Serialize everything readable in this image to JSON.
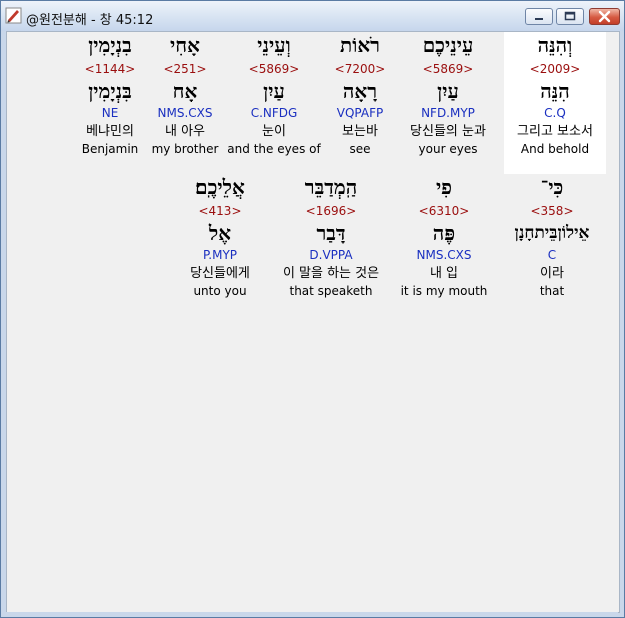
{
  "window": {
    "title": "@원전분해 - 창 45:12",
    "controls": {
      "minimize": "minimize-icon",
      "maximize": "maximize-icon",
      "close": "close-icon"
    },
    "colors": {
      "strong_number": "#9a0e0e",
      "morphology": "#1a2fc0",
      "highlight_bg": "#ffffff"
    }
  },
  "rows": [
    {
      "words": [
        {
          "hebrew": "וְהִנֵּה",
          "strong": "<2009>",
          "lemma": "הִנֵּה",
          "morph": "C.Q",
          "korean": "그리고 보소서",
          "english": "And behold",
          "selected": true
        },
        {
          "hebrew": "עֵינֵיכֶם",
          "strong": "<5869>",
          "lemma": "עַיִן",
          "morph": "NFD.MYP",
          "korean": "당신들의 눈과",
          "english": "your eyes"
        },
        {
          "hebrew": "רֹאוֹת",
          "strong": "<7200>",
          "lemma": "רָאָה",
          "morph": "VQPAFP",
          "korean": "보는바",
          "english": "see"
        },
        {
          "hebrew": "וְעֵינֵי",
          "strong": "<5869>",
          "lemma": "עַיִן",
          "morph": "C.NFDG",
          "korean": "눈이",
          "english": "and the eyes of"
        },
        {
          "hebrew": "אָחִי",
          "strong": "<251>",
          "lemma": "אָח",
          "morph": "NMS.CXS",
          "korean": "내 아우",
          "english": "my brother"
        },
        {
          "hebrew": "בִנְיָמִין",
          "strong": "<1144>",
          "lemma": "בִּנְיָמִין",
          "morph": "NE",
          "korean": "베냐민의",
          "english": "Benjamin"
        }
      ]
    },
    {
      "words": [
        {
          "hebrew": "כִּי־",
          "strong": "<358>",
          "lemma": "אֵילוֹן‎בֵּית‎חָנָן",
          "morph": "C",
          "korean": "이라",
          "english": "that"
        },
        {
          "hebrew": "פִי",
          "strong": "<6310>",
          "lemma": "פֶּה",
          "morph": "NMS.CXS",
          "korean": "내 입",
          "english": "it is my mouth"
        },
        {
          "hebrew": "הַֽמְדַבֵּר",
          "strong": "<1696>",
          "lemma": "דָּבַר",
          "morph": "D.VPPA",
          "korean": "이 말을 하는 것은",
          "english": "that speaketh"
        },
        {
          "hebrew": "אֲלֵיכֶֽם׃",
          "strong": "<413>",
          "lemma": "אֶל",
          "morph": "P.MYP",
          "korean": "당신들에게",
          "english": "unto you"
        }
      ]
    }
  ]
}
